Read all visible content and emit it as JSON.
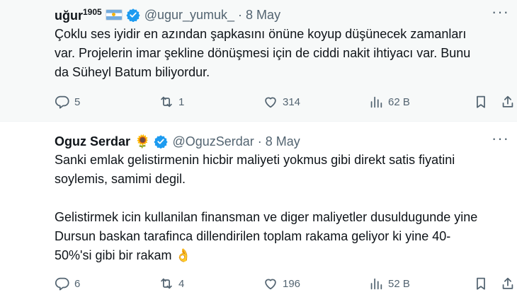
{
  "tweets": [
    {
      "name": "uğur",
      "name_sup": "1905",
      "handle": "@ugur_yumuk_",
      "separator": "·",
      "time": "8 May",
      "lines": [
        "Çoklu ses iyidir en azından şapkasını önüne koyup düşünecek zamanları",
        "var. Projelerin imar şekline dönüşmesi için de ciddi nakit ihtiyacı var. Bunu",
        "da Süheyl Batum biliyordur."
      ],
      "replies": "5",
      "retweets": "1",
      "likes": "314",
      "views": "62 B"
    },
    {
      "name": "Oguz Serdar",
      "name_emoji": "🌻",
      "handle": "@OguzSerdar",
      "separator": "·",
      "time": "8 May",
      "lines": [
        "Sanki emlak gelistirmenin hicbir maliyeti yokmus gibi direkt satis fiyatini",
        "soylemis, samimi degil.",
        "",
        "Gelistirmek icin kullanilan finansman ve diger maliyetler dusuldugunde yine",
        "Dursun baskan tarafinca dillendirilen toplam rakama geliyor ki yine 40-",
        "50%'si gibi bir rakam 👌"
      ],
      "replies": "6",
      "retweets": "4",
      "likes": "196",
      "views": "52 B"
    }
  ],
  "colors": {
    "verified": "#1d9bf0",
    "muted": "#536471",
    "text": "#0f1419"
  },
  "icons": [
    "reply-icon",
    "retweet-icon",
    "like-icon",
    "views-icon",
    "bookmark-icon",
    "share-icon",
    "more-icon",
    "verified-badge-icon"
  ]
}
